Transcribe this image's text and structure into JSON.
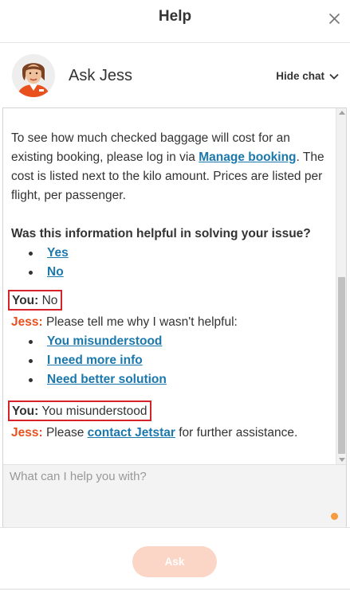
{
  "header": {
    "title": "Help",
    "close_icon": "close-icon"
  },
  "agent": {
    "name": "Ask Jess",
    "hide_chat_label": "Hide chat",
    "avatar_icon": "agent-avatar"
  },
  "transcript": {
    "partial_line": "… .. ..",
    "baggage_para": {
      "text_before": "To see how much checked baggage will cost for an existing booking, please log in via ",
      "link": "Manage booking",
      "text_after": ". The cost is listed next to the kilo amount. Prices are listed per flight, per passenger."
    },
    "question": "Was this information helpful in solving your issue?",
    "feedback_options": [
      "Yes",
      "No"
    ],
    "you_label": "You:",
    "jess_label": "Jess:",
    "you_msg_1": "No",
    "jess_msg_1": "Please tell me why I wasn't helpful:",
    "reason_options": [
      "You misunderstood",
      "I need more info",
      "Need better solution"
    ],
    "you_msg_2": "You misunderstood",
    "jess_msg_2": {
      "text_before": "Please ",
      "link": "contact Jetstar",
      "text_after": " for further assistance."
    }
  },
  "input": {
    "placeholder": "What can I help you with?"
  },
  "actions": {
    "ask_label": "Ask"
  },
  "colors": {
    "link": "#1a78ad",
    "jess": "#e8501e",
    "highlight_box": "#d6222a",
    "ask_button": "#fbd5c6",
    "status_dot": "#f79a3d"
  }
}
